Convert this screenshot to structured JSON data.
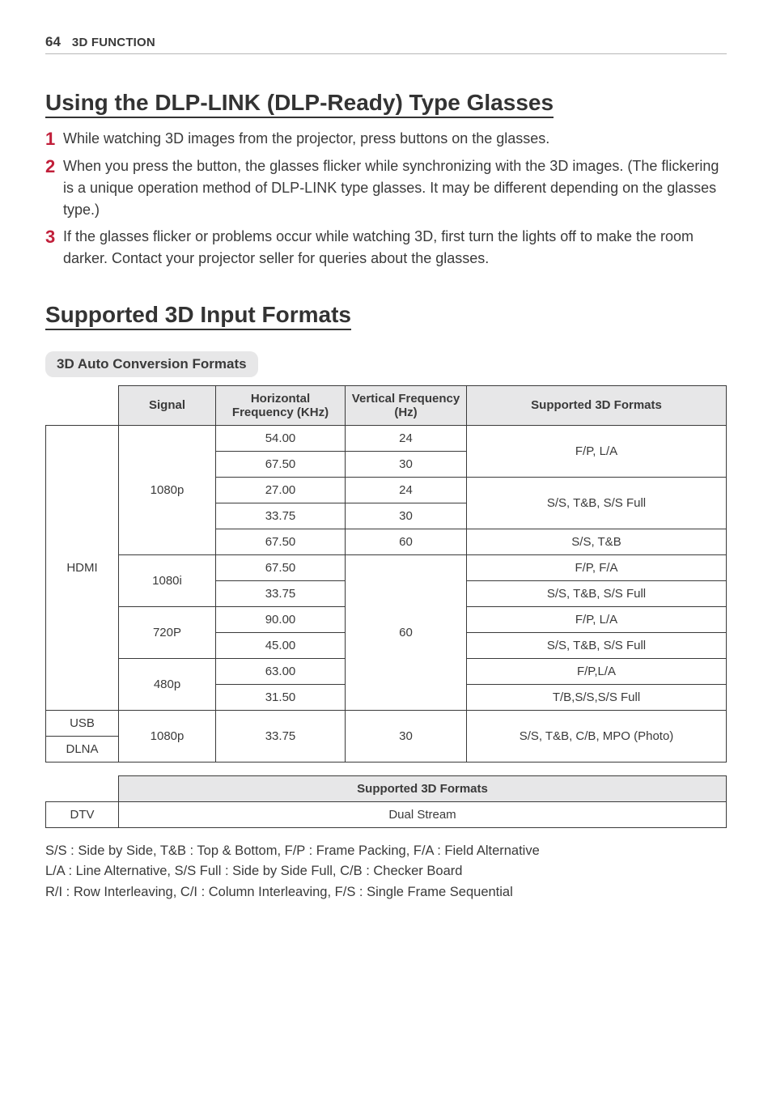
{
  "header": {
    "page_number": "64",
    "section_name": "3D FUNCTION"
  },
  "heading1": "Using the DLP-LINK (DLP-Ready) Type Glasses",
  "steps": [
    {
      "n": "1",
      "t": "While watching 3D images from the projector, press buttons on the glasses."
    },
    {
      "n": "2",
      "t": "When you press the button, the glasses flicker while synchronizing with the 3D images. (The flickering is a unique operation method of DLP-LINK type glasses. It may be different depending on the glasses type.)"
    },
    {
      "n": "3",
      "t": "If the glasses flicker or problems occur while watching 3D, first turn the lights off to make the room darker. Contact your projector seller for queries about the glasses."
    }
  ],
  "heading2": "Supported 3D Input Formats",
  "subhead": "3D Auto Conversion Formats",
  "table1": {
    "headers": {
      "signal": "Signal",
      "hfreq": "Horizontal Frequency (KHz)",
      "vfreq": "Vertical Frequency (Hz)",
      "formats": "Supported 3D Formats"
    },
    "sources": {
      "hdmi": "HDMI",
      "usb": "USB",
      "dlna": "DLNA"
    },
    "signals": {
      "s1080p": "1080p",
      "s1080i": "1080i",
      "s720P": "720P",
      "s480p": "480p"
    },
    "hfreq": {
      "v5400": "54.00",
      "v6750": "67.50",
      "v2700": "27.00",
      "v3375": "33.75",
      "v9000": "90.00",
      "v4500": "45.00",
      "v6300": "63.00",
      "v3150": "31.50"
    },
    "vfreq": {
      "v24": "24",
      "v30": "30",
      "v60": "60"
    },
    "formats": {
      "fp_la": "F/P, L/A",
      "ss_tb_ssfull": "S/S, T&B, S/S Full",
      "ss_tb": "S/S, T&B",
      "fp_fa": "F/P, F/A",
      "fpla": "F/P,L/A",
      "tb_ss_ssfull": "T/B,S/S,S/S Full",
      "ss_tb_cb_mpo": "S/S, T&B, C/B, MPO (Photo)"
    }
  },
  "table2": {
    "header": "Supported 3D Formats",
    "row": {
      "src": "DTV",
      "val": "Dual Stream"
    }
  },
  "legend": {
    "l1": "S/S : Side by Side, T&B : Top & Bottom, F/P : Frame Packing, F/A : Field Alternative",
    "l2": "L/A : Line Alternative, S/S Full : Side by Side Full, C/B : Checker Board",
    "l3": "R/I : Row Interleaving, C/I : Column Interleaving, F/S : Single Frame Sequential"
  }
}
